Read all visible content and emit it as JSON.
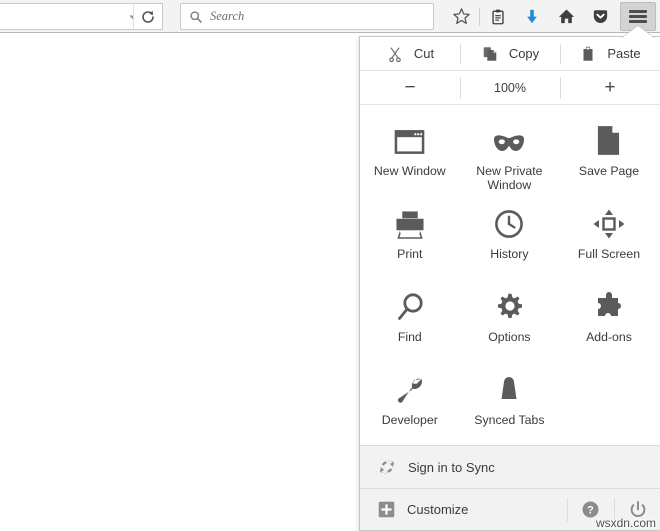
{
  "toolbar": {
    "url_dropdown_icon": "chevron-down-icon",
    "reload_icon": "reload-icon",
    "search": {
      "icon": "search-icon",
      "placeholder": "Search",
      "value": ""
    },
    "buttons": [
      {
        "name": "bookmark-star-button",
        "icon": "star-icon"
      },
      {
        "name": "reading-list-button",
        "icon": "clipboard-icon"
      },
      {
        "name": "downloads-button",
        "icon": "download-arrow-icon",
        "color": "#1f8ddb"
      },
      {
        "name": "home-button",
        "icon": "home-icon"
      },
      {
        "name": "pocket-button",
        "icon": "pocket-icon"
      }
    ],
    "menu_button": {
      "name": "hamburger-menu-button",
      "icon": "hamburger-icon",
      "state": "active"
    }
  },
  "panel": {
    "clipboard_row": [
      {
        "label": "Cut",
        "icon": "scissors-icon"
      },
      {
        "label": "Copy",
        "icon": "copy-icon"
      },
      {
        "label": "Paste",
        "icon": "clipboard-paste-icon"
      }
    ],
    "zoom_row": {
      "decrease_label": "−",
      "level": "100%",
      "increase_label": "+"
    },
    "grid": [
      {
        "label": "New Window",
        "icon": "window-icon"
      },
      {
        "label": "New Private Window",
        "icon": "mask-icon"
      },
      {
        "label": "Save Page",
        "icon": "document-icon"
      },
      {
        "label": "Print",
        "icon": "printer-icon"
      },
      {
        "label": "History",
        "icon": "clock-icon"
      },
      {
        "label": "Full Screen",
        "icon": "fullscreen-arrows-icon"
      },
      {
        "label": "Find",
        "icon": "magnifier-icon"
      },
      {
        "label": "Options",
        "icon": "gear-icon"
      },
      {
        "label": "Add-ons",
        "icon": "puzzle-piece-icon"
      },
      {
        "label": "Developer",
        "icon": "wrench-icon"
      },
      {
        "label": "Synced Tabs",
        "icon": "synced-device-icon"
      },
      {
        "label": "",
        "icon": ""
      }
    ],
    "sync": {
      "label": "Sign in to Sync",
      "icon": "sync-icon"
    },
    "customize": {
      "label": "Customize",
      "icon": "plus-box-icon"
    },
    "help": {
      "icon": "help-circle-icon"
    },
    "quit": {
      "icon": "power-icon"
    }
  },
  "watermark": "wsxdn.com",
  "colors": {
    "toolbar_bg": "#f3f3f3",
    "panel_bg": "#ffffff",
    "footer_bg": "#f2f2f2",
    "icon_gray": "#5b5b5b",
    "text": "#3b3b3b",
    "download_blue": "#1f8ddb"
  }
}
